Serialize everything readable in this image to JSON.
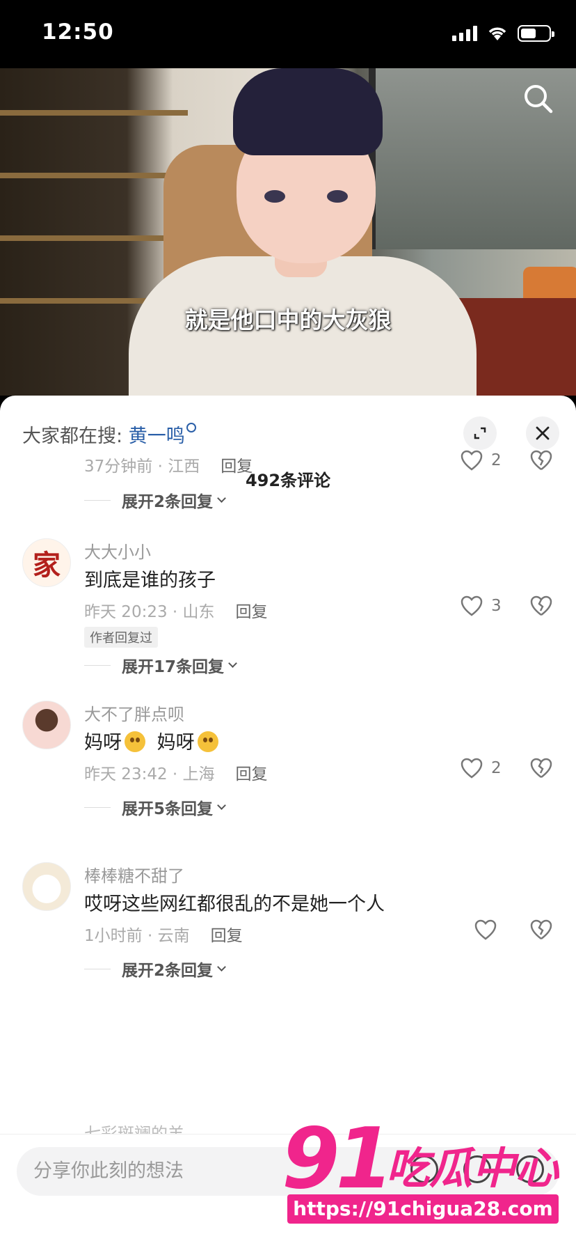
{
  "status_bar": {
    "time": "12:50"
  },
  "video": {
    "subtitle": "就是他口中的大灰狼"
  },
  "sheet": {
    "search_prefix": "大家都在搜:",
    "search_keyword": "黄一鸣",
    "comment_count": "492条评论"
  },
  "comments": [
    {
      "username": "",
      "text": "",
      "time_location": "37分钟前 · 江西",
      "reply": "回复",
      "likes": "2",
      "expand": "展开2条回复"
    },
    {
      "username": "大大小小",
      "text": "到底是谁的孩子",
      "time_location": "昨天 20:23 · 山东",
      "reply": "回复",
      "likes": "3",
      "tag": "作者回复过",
      "expand": "展开17条回复",
      "avatar_char": "家"
    },
    {
      "username": "大不了胖点呗",
      "text_part1": "妈呀",
      "text_part2": "妈呀",
      "time_location": "昨天 23:42 · 上海",
      "reply": "回复",
      "likes": "2",
      "expand": "展开5条回复"
    },
    {
      "username": "棒棒糖不甜了",
      "text": "哎呀这些网红都很乱的不是她一个人",
      "time_location": "1小时前 · 云南",
      "reply": "回复",
      "likes": "",
      "expand": "展开2条回复"
    }
  ],
  "partial_comment": {
    "username": "七彩斑斓的羊"
  },
  "input": {
    "placeholder": "分享你此刻的想法"
  },
  "watermark": {
    "number": "91",
    "text": "吃瓜中心",
    "url": "https://91chigua28.com"
  },
  "colors": {
    "keyword": "#2a5fa8",
    "watermark": "#f0258c"
  }
}
